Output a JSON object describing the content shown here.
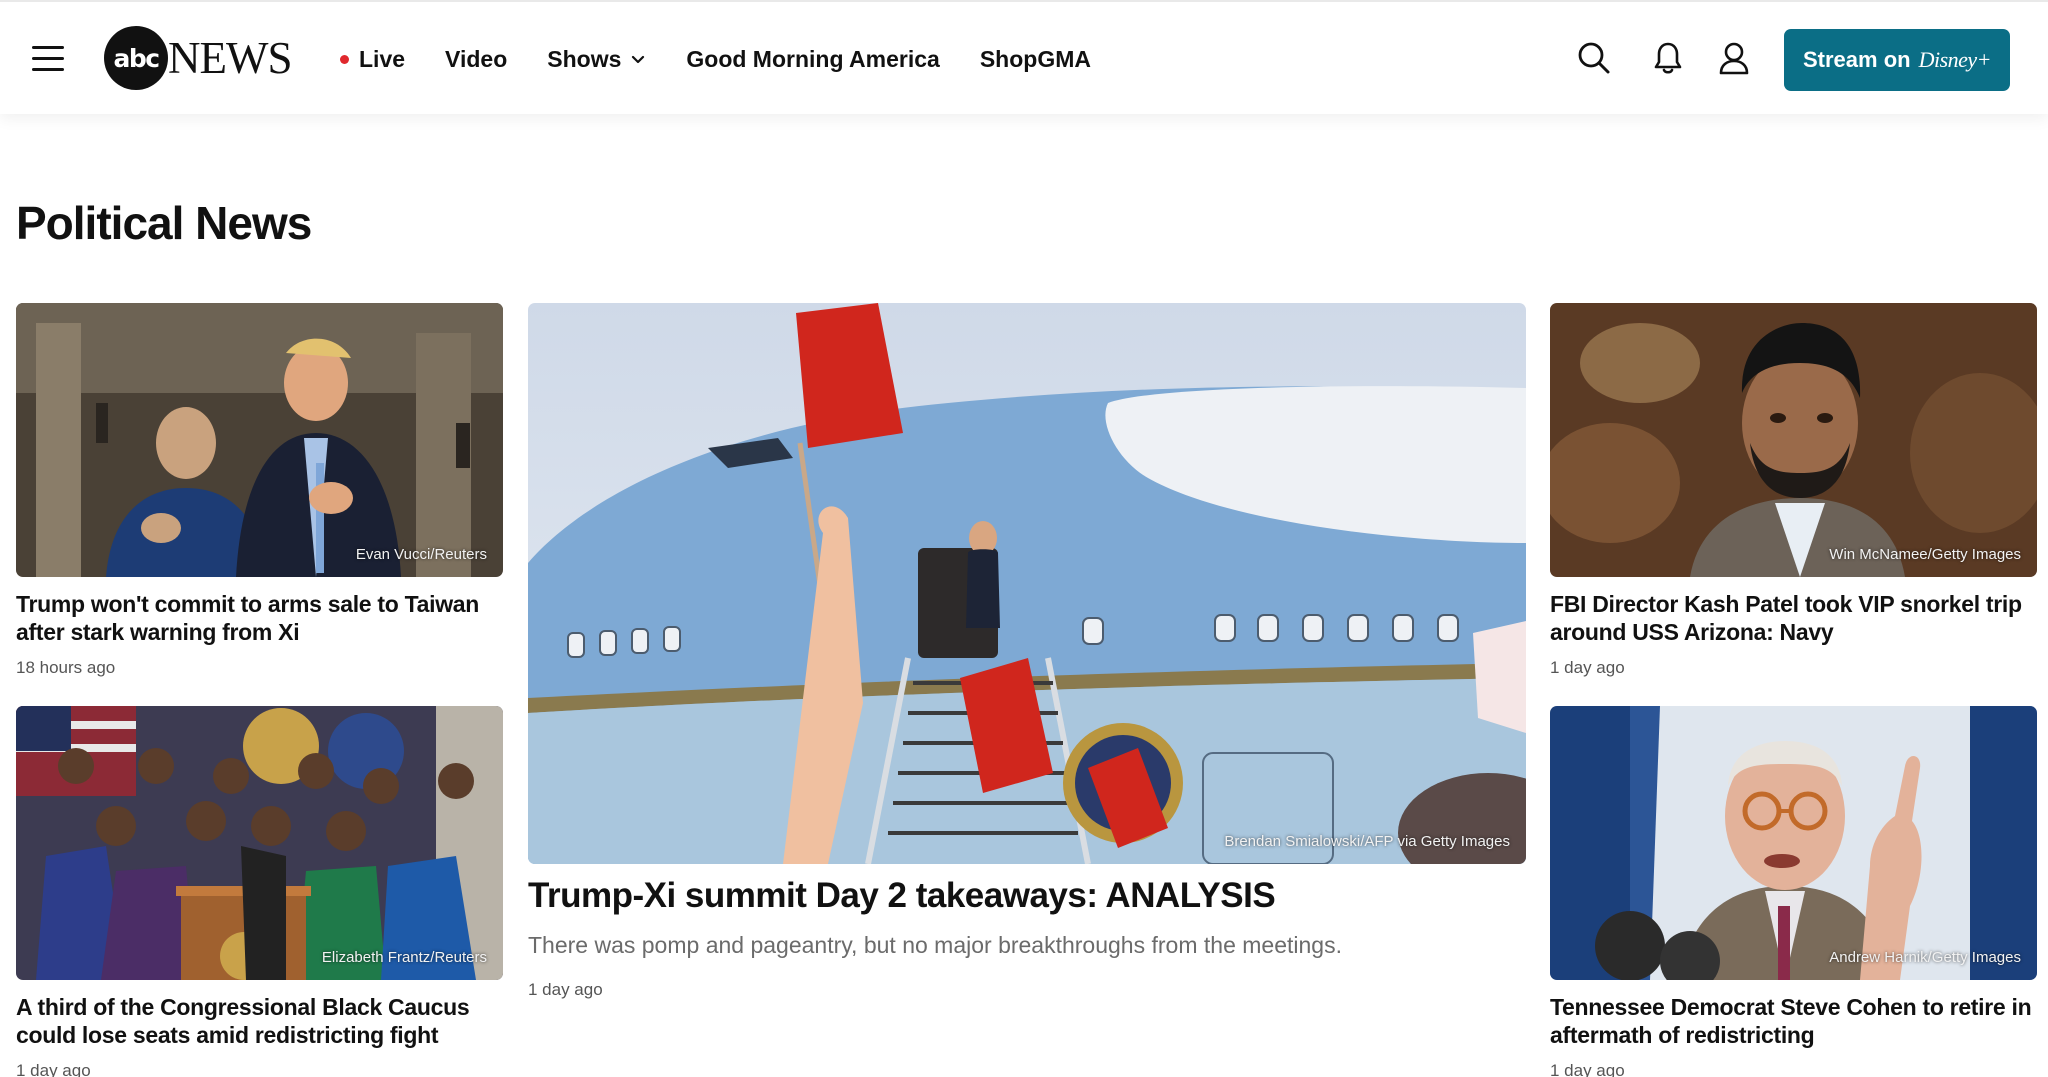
{
  "header": {
    "logo_mark": "abc",
    "logo_text": "NEWS",
    "nav": [
      {
        "label": "Live"
      },
      {
        "label": "Video"
      },
      {
        "label": "Shows"
      },
      {
        "label": "Good Morning America"
      },
      {
        "label": "ShopGMA"
      }
    ],
    "stream_button": {
      "label": "Stream on",
      "brand": "Disney+"
    },
    "icons": [
      "hamburger-icon",
      "search-icon",
      "bell-icon",
      "user-icon",
      "chevron-down-icon"
    ],
    "live_dot_color": "#e0282d",
    "accent_color": "#0b6e86"
  },
  "section": {
    "title": "Political News"
  },
  "stories": {
    "top_left": {
      "headline": "Trump won't commit to arms sale to Taiwan after stark warning from Xi",
      "time": "18 hours ago",
      "credit": "Evan Vucci/Reuters"
    },
    "bottom_left": {
      "headline": "A third of the Congressional Black Caucus could lose seats amid redistricting fight",
      "time": "1 day ago",
      "credit": "Elizabeth Frantz/Reuters"
    },
    "featured": {
      "headline": "Trump-Xi summit Day 2 takeaways: ANALYSIS",
      "summary": "There was pomp and pageantry, but no major breakthroughs from the meetings.",
      "time": "1 day ago",
      "credit": "Brendan Smialowski/AFP via Getty Images"
    },
    "top_right": {
      "headline": "FBI Director Kash Patel took VIP snorkel trip around USS Arizona: Navy",
      "time": "1 day ago",
      "credit": "Win McNamee/Getty Images"
    },
    "bottom_right": {
      "headline": "Tennessee Democrat Steve Cohen to retire in aftermath of redistricting",
      "time": "1 day ago",
      "credit": "Andrew Harnik/Getty Images"
    }
  }
}
